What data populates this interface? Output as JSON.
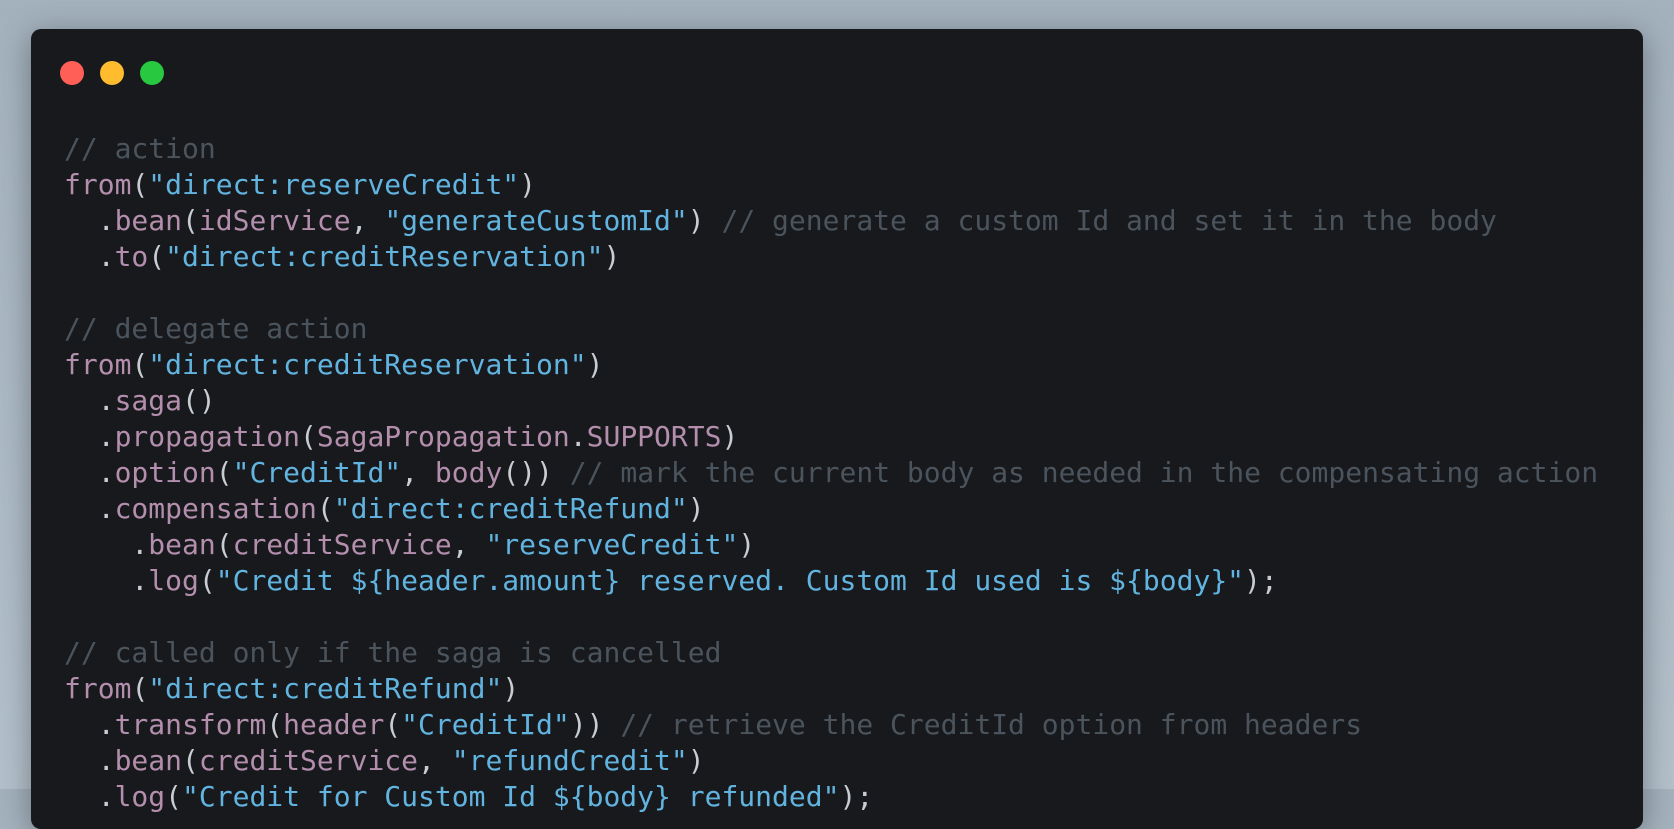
{
  "window": {
    "controls": {
      "close_color": "#ff5f57",
      "minimize_color": "#febc2e",
      "maximize_color": "#28c840"
    }
  },
  "code": {
    "lines": [
      [
        {
          "t": "// action",
          "k": "comment"
        }
      ],
      [
        {
          "t": "from",
          "k": "fn"
        },
        {
          "t": "(",
          "k": "punct"
        },
        {
          "t": "\"direct:reserveCredit\"",
          "k": "str"
        },
        {
          "t": ")",
          "k": "punct"
        }
      ],
      [
        {
          "t": "  .",
          "k": "punct"
        },
        {
          "t": "bean",
          "k": "fn"
        },
        {
          "t": "(",
          "k": "punct"
        },
        {
          "t": "idService",
          "k": "id"
        },
        {
          "t": ", ",
          "k": "punct"
        },
        {
          "t": "\"generateCustomId\"",
          "k": "str"
        },
        {
          "t": ") ",
          "k": "punct"
        },
        {
          "t": "// generate a custom Id and set it in the body",
          "k": "comment"
        }
      ],
      [
        {
          "t": "  .",
          "k": "punct"
        },
        {
          "t": "to",
          "k": "fn"
        },
        {
          "t": "(",
          "k": "punct"
        },
        {
          "t": "\"direct:creditReservation\"",
          "k": "str"
        },
        {
          "t": ")",
          "k": "punct"
        }
      ],
      [],
      [
        {
          "t": "// delegate action",
          "k": "comment"
        }
      ],
      [
        {
          "t": "from",
          "k": "fn"
        },
        {
          "t": "(",
          "k": "punct"
        },
        {
          "t": "\"direct:creditReservation\"",
          "k": "str"
        },
        {
          "t": ")",
          "k": "punct"
        }
      ],
      [
        {
          "t": "  .",
          "k": "punct"
        },
        {
          "t": "saga",
          "k": "fn"
        },
        {
          "t": "()",
          "k": "punct"
        }
      ],
      [
        {
          "t": "  .",
          "k": "punct"
        },
        {
          "t": "propagation",
          "k": "fn"
        },
        {
          "t": "(",
          "k": "punct"
        },
        {
          "t": "SagaPropagation",
          "k": "id"
        },
        {
          "t": ".",
          "k": "punct"
        },
        {
          "t": "SUPPORTS",
          "k": "id"
        },
        {
          "t": ")",
          "k": "punct"
        }
      ],
      [
        {
          "t": "  .",
          "k": "punct"
        },
        {
          "t": "option",
          "k": "fn"
        },
        {
          "t": "(",
          "k": "punct"
        },
        {
          "t": "\"CreditId\"",
          "k": "str"
        },
        {
          "t": ", ",
          "k": "punct"
        },
        {
          "t": "body",
          "k": "fn"
        },
        {
          "t": "()) ",
          "k": "punct"
        },
        {
          "t": "// mark the current body as needed in the compensating action",
          "k": "comment"
        }
      ],
      [
        {
          "t": "  .",
          "k": "punct"
        },
        {
          "t": "compensation",
          "k": "fn"
        },
        {
          "t": "(",
          "k": "punct"
        },
        {
          "t": "\"direct:creditRefund\"",
          "k": "str"
        },
        {
          "t": ")",
          "k": "punct"
        }
      ],
      [
        {
          "t": "    .",
          "k": "punct"
        },
        {
          "t": "bean",
          "k": "fn"
        },
        {
          "t": "(",
          "k": "punct"
        },
        {
          "t": "creditService",
          "k": "id"
        },
        {
          "t": ", ",
          "k": "punct"
        },
        {
          "t": "\"reserveCredit\"",
          "k": "str"
        },
        {
          "t": ")",
          "k": "punct"
        }
      ],
      [
        {
          "t": "    .",
          "k": "punct"
        },
        {
          "t": "log",
          "k": "fn"
        },
        {
          "t": "(",
          "k": "punct"
        },
        {
          "t": "\"Credit ${header.amount} reserved. Custom Id used is ${body}\"",
          "k": "str"
        },
        {
          "t": ");",
          "k": "punct"
        }
      ],
      [],
      [
        {
          "t": "// called only if the saga is cancelled",
          "k": "comment"
        }
      ],
      [
        {
          "t": "from",
          "k": "fn"
        },
        {
          "t": "(",
          "k": "punct"
        },
        {
          "t": "\"direct:creditRefund\"",
          "k": "str"
        },
        {
          "t": ")",
          "k": "punct"
        }
      ],
      [
        {
          "t": "  .",
          "k": "punct"
        },
        {
          "t": "transform",
          "k": "fn"
        },
        {
          "t": "(",
          "k": "punct"
        },
        {
          "t": "header",
          "k": "fn"
        },
        {
          "t": "(",
          "k": "punct"
        },
        {
          "t": "\"CreditId\"",
          "k": "str"
        },
        {
          "t": ")) ",
          "k": "punct"
        },
        {
          "t": "// retrieve the CreditId option from headers",
          "k": "comment"
        }
      ],
      [
        {
          "t": "  .",
          "k": "punct"
        },
        {
          "t": "bean",
          "k": "fn"
        },
        {
          "t": "(",
          "k": "punct"
        },
        {
          "t": "creditService",
          "k": "id"
        },
        {
          "t": ", ",
          "k": "punct"
        },
        {
          "t": "\"refundCredit\"",
          "k": "str"
        },
        {
          "t": ")",
          "k": "punct"
        }
      ],
      [
        {
          "t": "  .",
          "k": "punct"
        },
        {
          "t": "log",
          "k": "fn"
        },
        {
          "t": "(",
          "k": "punct"
        },
        {
          "t": "\"Credit for Custom Id ${body} refunded\"",
          "k": "str"
        },
        {
          "t": ");",
          "k": "punct"
        }
      ]
    ]
  }
}
